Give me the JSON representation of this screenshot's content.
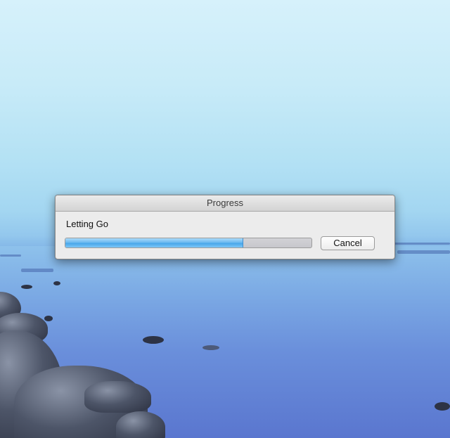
{
  "dialog": {
    "title": "Progress",
    "message": "Letting Go",
    "progress_percent": 72,
    "cancel_label": "Cancel"
  },
  "colors": {
    "progress_fill": "#5ab2ee",
    "progress_track": "#c9c9ce",
    "dialog_background": "#ececec"
  }
}
